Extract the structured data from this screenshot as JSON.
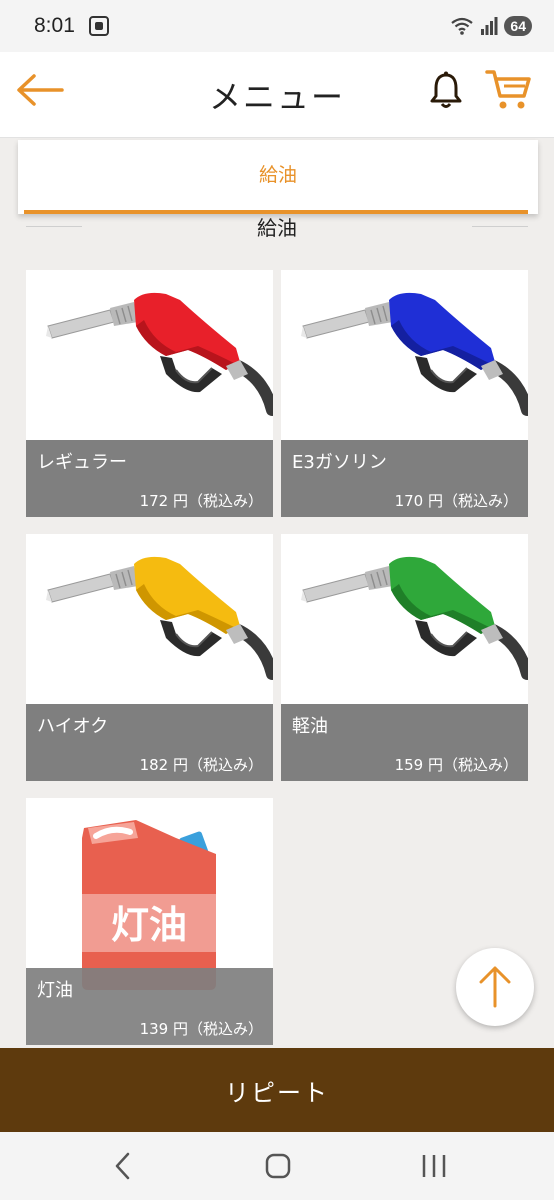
{
  "status_bar": {
    "time": "8:01",
    "battery": "64"
  },
  "header": {
    "title": "メニュー"
  },
  "tabs": [
    {
      "label": "給油",
      "active": true
    }
  ],
  "section": {
    "title": "給油"
  },
  "products": [
    {
      "name": "レギュラー",
      "price": "172 円（税込み）",
      "nozzle_color": "#e8202a",
      "nozzle_dark": "#b8141c"
    },
    {
      "name": "E3ガソリン",
      "price": "170 円（税込み）",
      "nozzle_color": "#1f2fd6",
      "nozzle_dark": "#1420a0"
    },
    {
      "name": "ハイオク",
      "price": "182 円（税込み）",
      "nozzle_color": "#f5bb10",
      "nozzle_dark": "#cf9600"
    },
    {
      "name": "軽油",
      "price": "159 円（税込み）",
      "nozzle_color": "#2fa83a",
      "nozzle_dark": "#1f7f28"
    },
    {
      "name": "灯油",
      "price": "139 円（税込み）",
      "can_label": "灯油",
      "can_color": "#e8604f"
    }
  ],
  "repeat_button": {
    "label": "リピート"
  },
  "colors": {
    "accent": "#e8922a",
    "repeat_bar": "#5e3a0d",
    "caption_bg": "#7f7f7f"
  }
}
